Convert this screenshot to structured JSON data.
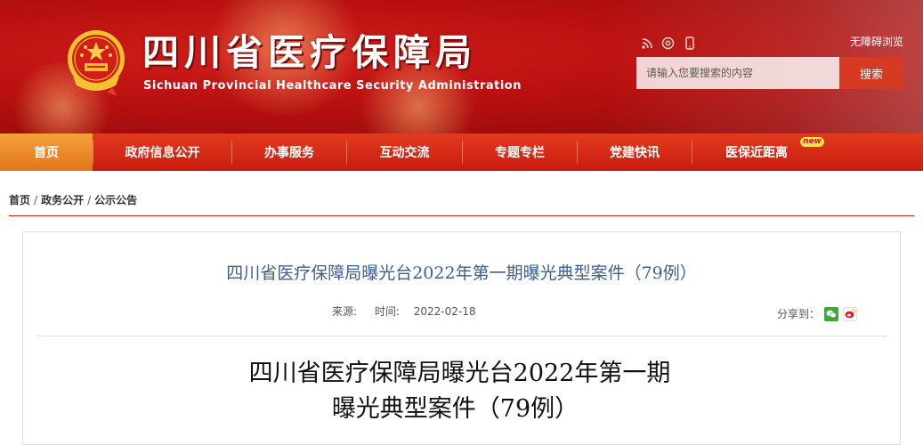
{
  "header": {
    "site_title": "四川省医疗保障局",
    "site_subtitle": "Sichuan Provincial Healthcare Security Administration",
    "accessibility_label": "无障碍浏览",
    "icons": [
      "rss-icon",
      "weibo-icon",
      "mobile-icon"
    ],
    "search": {
      "placeholder": "请输入您要搜索的内容",
      "button_label": "搜索"
    }
  },
  "nav": {
    "items": [
      {
        "label": "首页",
        "active": true
      },
      {
        "label": "政府信息公开"
      },
      {
        "label": "办事服务"
      },
      {
        "label": "互动交流"
      },
      {
        "label": "专题专栏"
      },
      {
        "label": "党建快讯"
      },
      {
        "label": "医保近距离",
        "badge": "new"
      }
    ]
  },
  "breadcrumb": {
    "items": [
      "首页",
      "政务公开",
      "公示公告"
    ],
    "separator": "/"
  },
  "article": {
    "header_title": "四川省医疗保障局曝光台2022年第一期曝光典型案件（79例）",
    "meta": {
      "source_label": "来源:",
      "source_value": "",
      "time_label": "时间:",
      "time_value": "2022-02-18"
    },
    "share_label": "分享到：",
    "share_icons": [
      "wechat-icon",
      "weibo-icon"
    ],
    "big_title_line1": "四川省医疗保障局曝光台2022年第一期",
    "big_title_line2": "曝光典型案件（79例）"
  },
  "colors": {
    "banner_red": "#b8100f",
    "nav_red": "#d42b18",
    "nav_active": "#ee8c2a",
    "title_blue": "#3e5e8c",
    "rule_red": "#b3261e"
  }
}
